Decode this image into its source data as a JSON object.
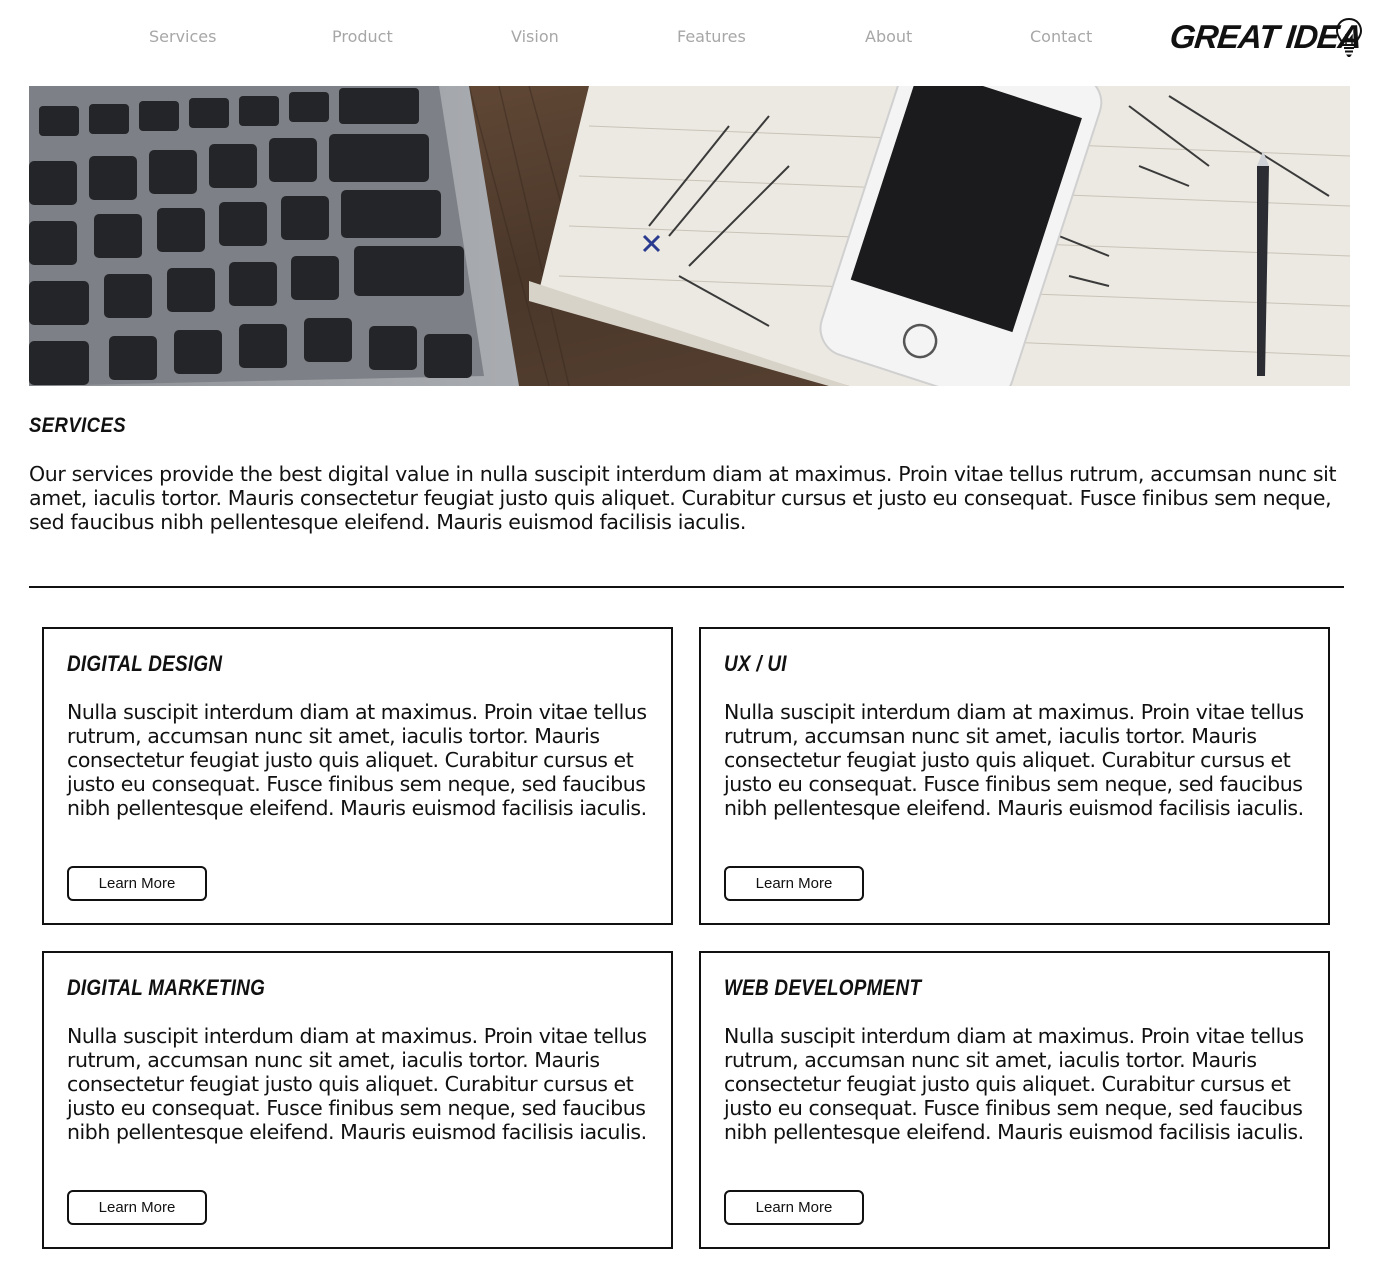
{
  "nav": {
    "links": [
      {
        "label": "Services"
      },
      {
        "label": "Product"
      },
      {
        "label": "Vision"
      },
      {
        "label": "Features"
      },
      {
        "label": "About"
      },
      {
        "label": "Contact"
      }
    ],
    "logo_text": "GREAT IDEA",
    "logo_icon": "lightbulb-icon"
  },
  "hero": {
    "image": "workspace photo: laptop keyboard, smartphone and handwritten notebook with pen on wooden desk"
  },
  "services": {
    "title": "Services",
    "intro": "Our services provide the best digital value in nulla suscipit interdum diam at maximus. Proin vitae tellus rutrum, accumsan nunc sit amet, iaculis tortor. Mauris consectetur feugiat justo quis aliquet. Curabitur cursus et justo eu consequat. Fusce finibus sem neque, sed faucibus nibh pellentesque eleifend. Mauris euismod facilisis iaculis."
  },
  "cards": [
    {
      "title": "Digital Design",
      "text": "Nulla suscipit interdum diam at maximus. Proin vitae tellus rutrum, accumsan nunc sit amet, iaculis tortor. Mauris consectetur feugiat justo quis aliquet. Curabitur cursus et justo eu consequat. Fusce finibus sem neque, sed faucibus nibh pellentesque eleifend. Mauris euismod facilisis iaculis.",
      "button": "Learn More"
    },
    {
      "title": "UX / UI",
      "text": "Nulla suscipit interdum diam at maximus. Proin vitae tellus rutrum, accumsan nunc sit amet, iaculis tortor. Mauris consectetur feugiat justo quis aliquet. Curabitur cursus et justo eu consequat. Fusce finibus sem neque, sed faucibus nibh pellentesque eleifend. Mauris euismod facilisis iaculis.",
      "button": "Learn More"
    },
    {
      "title": "Digital Marketing",
      "text": "Nulla suscipit interdum diam at maximus. Proin vitae tellus rutrum, accumsan nunc sit amet, iaculis tortor. Mauris consectetur feugiat justo quis aliquet. Curabitur cursus et justo eu consequat. Fusce finibus sem neque, sed faucibus nibh pellentesque eleifend. Mauris euismod facilisis iaculis.",
      "button": "Learn More"
    },
    {
      "title": "Web Development",
      "text": "Nulla suscipit interdum diam at maximus. Proin vitae tellus rutrum, accumsan nunc sit amet, iaculis tortor. Mauris consectetur feugiat justo quis aliquet. Curabitur cursus et justo eu consequat. Fusce finibus sem neque, sed faucibus nibh pellentesque eleifend. Mauris euismod facilisis iaculis.",
      "button": "Learn More"
    }
  ],
  "colors": {
    "nav_link": "#a7a7a7",
    "text": "#111111",
    "border": "#111111",
    "background": "#ffffff"
  }
}
